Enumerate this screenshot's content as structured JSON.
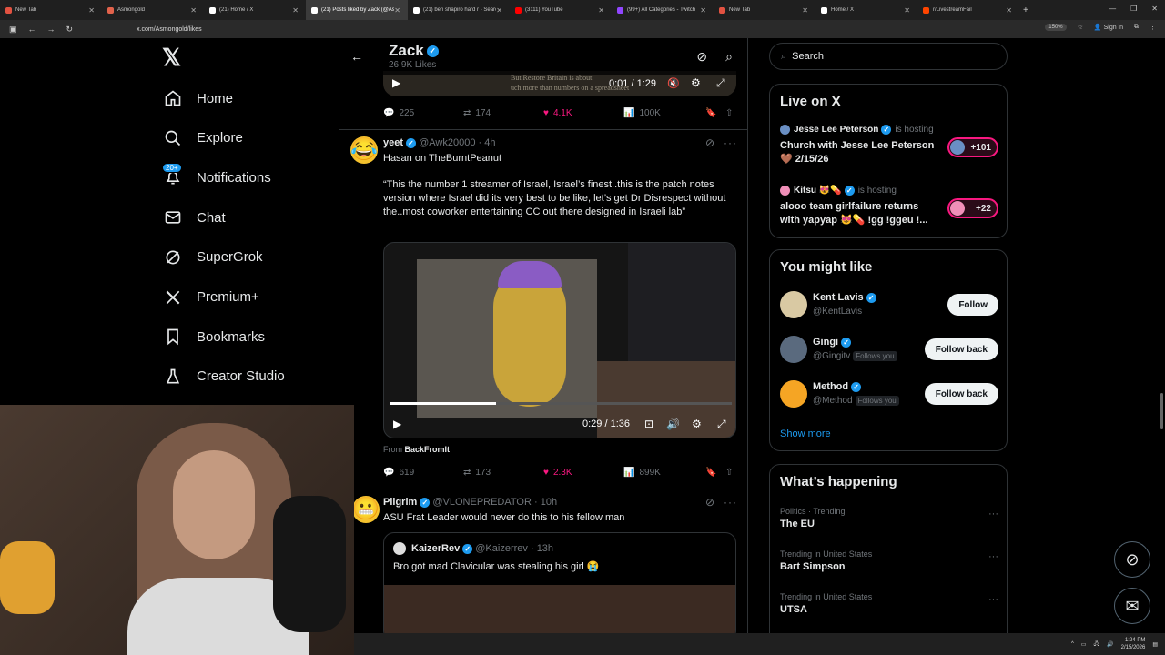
{
  "browser": {
    "tabs": [
      {
        "title": "New Tab",
        "color": "#e25241",
        "active": false
      },
      {
        "title": "Asmongold",
        "color": "#e2624b",
        "active": false
      },
      {
        "title": "(21) Home / X",
        "color": "#ffffff",
        "active": false
      },
      {
        "title": "(21) Posts liked by Zack (@Asm",
        "color": "#ffffff",
        "active": true
      },
      {
        "title": "(21) ben shapiro hard r - Search",
        "color": "#ffffff",
        "active": false
      },
      {
        "title": "(3111) YouTube",
        "color": "#ff0000",
        "active": false
      },
      {
        "title": "(99+) All Categories - Twitch",
        "color": "#9146ff",
        "active": false
      },
      {
        "title": "New Tab",
        "color": "#e25241",
        "active": false
      },
      {
        "title": "Home / X",
        "color": "#ffffff",
        "active": false
      },
      {
        "title": "r/LivestreamFail",
        "color": "#ff4500",
        "active": false
      }
    ],
    "new_tab": "+",
    "url": "x.com/Asmongold/likes",
    "zoom": "150%",
    "profile_label": "Sign in",
    "window_controls": [
      "—",
      "❐",
      "✕"
    ]
  },
  "sidenav": {
    "logo": "𝕏",
    "notifications_badge": "20+",
    "items": [
      {
        "label": "Home",
        "icon": "home-icon"
      },
      {
        "label": "Explore",
        "icon": "search-icon"
      },
      {
        "label": "Notifications",
        "icon": "bell-icon"
      },
      {
        "label": "Chat",
        "icon": "mail-icon"
      },
      {
        "label": "SuperGrok",
        "icon": "grok-icon"
      },
      {
        "label": "Premium+",
        "icon": "x-icon"
      },
      {
        "label": "Bookmarks",
        "icon": "bookmark-icon"
      },
      {
        "label": "Creator Studio",
        "icon": "flask-icon"
      }
    ]
  },
  "profile_header": {
    "name": "Zack",
    "likes": "26.9K Likes"
  },
  "posts": [
    {
      "video_time": "0:01 / 1:29",
      "video_text": "But Restore Britain is about\nuch more than numbers on a spreadsheet",
      "stats": {
        "replies": "225",
        "reposts": "174",
        "likes": "4.1K",
        "views": "100K"
      }
    },
    {
      "name": "yeet",
      "handle": "@Awk20000",
      "time": "· 4h",
      "line1": "Hasan on TheBurntPeanut",
      "line2": "“This the number 1 streamer of Israel, Israel’s finest..this is the patch notes version where Israel did its very best to be like, let’s get Dr Disrespect without the..most coworker entertaining CC out there designed in Israeli lab”",
      "video_time": "0:29 / 1:36",
      "video_progress": 0.31,
      "from_label": "From",
      "from_source": "BackFromIt",
      "stats": {
        "replies": "619",
        "reposts": "173",
        "likes": "2.3K",
        "views": "899K"
      }
    },
    {
      "name": "Pilgrim",
      "handle": "@VLONEPREDATOR",
      "time": "· 10h",
      "text": "ASU Frat Leader would never do this to his fellow man",
      "quote": {
        "name": "KaizerRev",
        "handle": "@Kaizerrev",
        "time": "· 13h",
        "text": "Bro got mad Clavicular was stealing his girl 😭"
      }
    }
  ],
  "rightcol": {
    "search_placeholder": "Search",
    "live": {
      "title": "Live on X",
      "items": [
        {
          "host": "Jesse Lee Peterson",
          "status": "is hosting",
          "title": "Church with Jesse Lee Peterson 🤎 2/15/26",
          "count": "+101",
          "color": "#6a8fc4"
        },
        {
          "host": "Kitsu 😻💊",
          "status": "is hosting",
          "title": "alooo team girlfailure returns with yapyap 😻💊 !gg !ggeu !...",
          "count": "+22",
          "color": "#f08fb8"
        }
      ]
    },
    "might_like": {
      "title": "You might like",
      "items": [
        {
          "name": "Kent Lavis",
          "handle": "@KentLavis",
          "follows_you": "",
          "button": "Follow",
          "color": "#d9c9a3"
        },
        {
          "name": "Gingi",
          "handle": "@Gingitv",
          "follows_you": "Follows you",
          "button": "Follow back",
          "color": "#5a6a7e"
        },
        {
          "name": "Method",
          "handle": "@Method",
          "follows_you": "Follows you",
          "button": "Follow back",
          "color": "#f5a524"
        }
      ],
      "show_more": "Show more"
    },
    "happening": {
      "title": "What’s happening",
      "items": [
        {
          "category": "Politics · Trending",
          "name": "The EU"
        },
        {
          "category": "Trending in United States",
          "name": "Bart Simpson"
        },
        {
          "category": "Trending in United States",
          "name": "UTSA"
        }
      ]
    }
  },
  "taskbar": {
    "time": "1:24 PM",
    "date": "2/15/2026"
  }
}
